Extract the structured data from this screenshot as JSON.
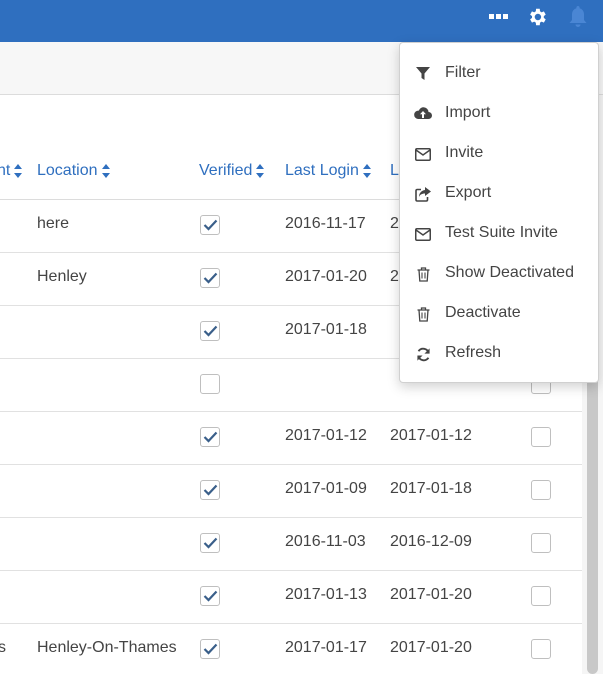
{
  "topbar": {
    "color": "#2f6fbf",
    "icons": [
      "more-dots-icon",
      "gear-icon",
      "bell-icon"
    ]
  },
  "table": {
    "headers": {
      "col1_partial": "nt",
      "location": "Location",
      "verified": "Verified",
      "last_login": "Last Login",
      "col5_partial": "L"
    },
    "rows": [
      {
        "col1": "",
        "location": "here",
        "verified": true,
        "last_login": "2016-11-17",
        "col5": "2",
        "checked": false
      },
      {
        "col1": "",
        "location": "Henley",
        "verified": true,
        "last_login": "2017-01-20",
        "col5": "2",
        "checked": false
      },
      {
        "col1": "",
        "location": "",
        "verified": true,
        "last_login": "2017-01-18",
        "col5": "",
        "checked": false
      },
      {
        "col1": "",
        "location": "",
        "verified": false,
        "last_login": "",
        "col5": "",
        "checked": false
      },
      {
        "col1": "",
        "location": "",
        "verified": true,
        "last_login": "2017-01-12",
        "col5": "2017-01-12",
        "checked": false
      },
      {
        "col1": "",
        "location": "",
        "verified": true,
        "last_login": "2017-01-09",
        "col5": "2017-01-18",
        "checked": false
      },
      {
        "col1": "",
        "location": "",
        "verified": true,
        "last_login": "2016-11-03",
        "col5": "2016-12-09",
        "checked": false
      },
      {
        "col1": "",
        "location": "",
        "verified": true,
        "last_login": "2017-01-13",
        "col5": "2017-01-20",
        "checked": false
      },
      {
        "col1": "s",
        "location": "Henley-On-Thames",
        "verified": true,
        "last_login": "2017-01-17",
        "col5": "2017-01-20",
        "checked": false
      }
    ]
  },
  "menu": {
    "items": [
      {
        "label": "Filter",
        "icon": "filter-icon"
      },
      {
        "label": "Import",
        "icon": "cloud-upload-icon"
      },
      {
        "label": "Invite",
        "icon": "envelope-icon"
      },
      {
        "label": "Export",
        "icon": "share-icon"
      },
      {
        "label": "Test Suite Invite",
        "icon": "envelope-icon"
      },
      {
        "label": "Show Deactivated",
        "icon": "trash-icon"
      },
      {
        "label": "Deactivate",
        "icon": "trash-icon"
      },
      {
        "label": "Refresh",
        "icon": "refresh-icon"
      }
    ]
  }
}
